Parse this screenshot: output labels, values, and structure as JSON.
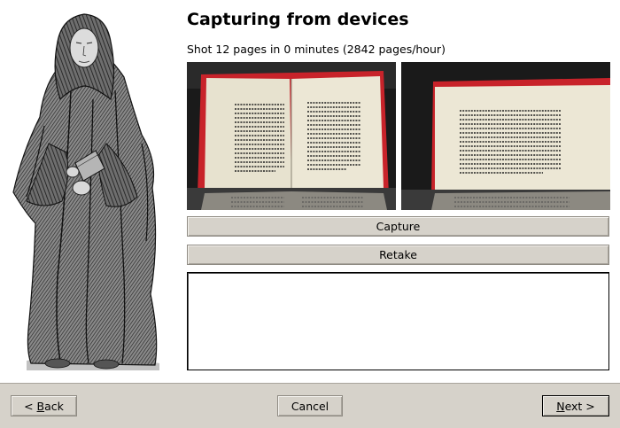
{
  "page": {
    "title": "Capturing from devices",
    "status": "Shot 12 pages in 0 minutes (2842 pages/hour)"
  },
  "buttons": {
    "capture": "Capture",
    "retake": "Retake"
  },
  "log": {
    "text": ""
  },
  "nav": {
    "back": {
      "prefix": "< ",
      "mnemonic": "B",
      "rest": "ack"
    },
    "cancel": "Cancel",
    "next": {
      "mnemonic": "N",
      "rest": "ext >"
    }
  },
  "colors": {
    "button_bg": "#d6d2ca",
    "book_cover": "#c8232a",
    "page_paper": "#e7e2cf"
  }
}
